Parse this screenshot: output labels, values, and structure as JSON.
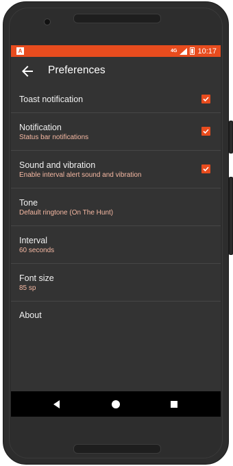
{
  "status_bar": {
    "app_icon_letter": "A",
    "signal_label": "4G",
    "time": "10:17"
  },
  "toolbar": {
    "title": "Preferences"
  },
  "preferences": {
    "items": [
      {
        "title": "Toast notification",
        "summary": null,
        "checked": true
      },
      {
        "title": "Notification",
        "summary": "Status bar notifications",
        "checked": true
      },
      {
        "title": "Sound and vibration",
        "summary": "Enable interval alert sound and vibration",
        "checked": true
      },
      {
        "title": "Tone",
        "summary": "Default ringtone (On The Hunt)",
        "checked": null
      },
      {
        "title": "Interval",
        "summary": "60 seconds",
        "checked": null
      },
      {
        "title": "Font size",
        "summary": "85 sp",
        "checked": null
      },
      {
        "title": "About",
        "summary": null,
        "checked": null
      }
    ]
  },
  "colors": {
    "accent": "#e84c1e",
    "background": "#333333",
    "summary_text": "#f6b9a3"
  },
  "icons": {
    "back": "arrow-left-icon",
    "nav_back": "triangle-back-icon",
    "nav_home": "circle-home-icon",
    "nav_recent": "square-recents-icon"
  }
}
